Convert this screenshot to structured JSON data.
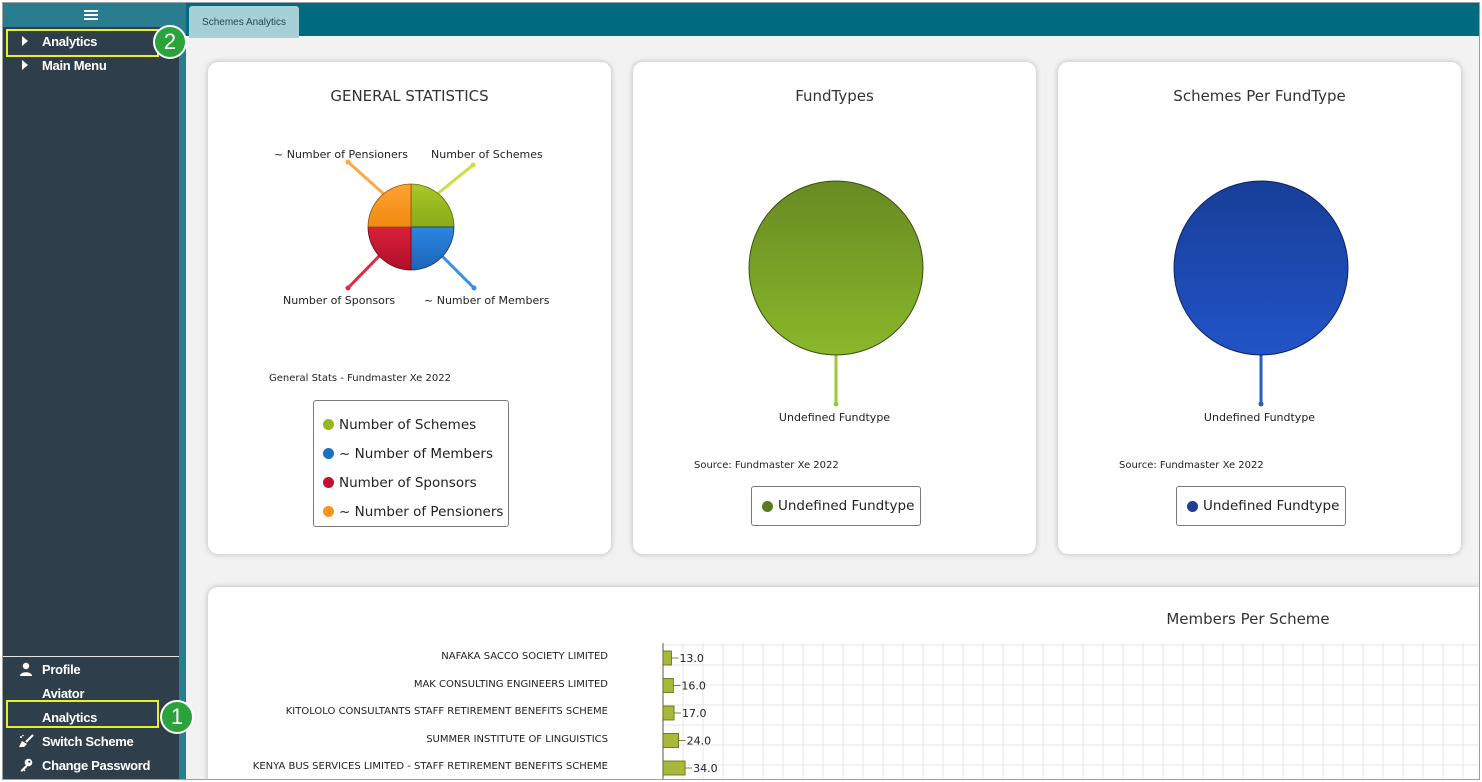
{
  "sidebar": {
    "menu_icon": "hamburger-icon",
    "top_items": [
      {
        "label": "Analytics",
        "icon": "caret-right-icon"
      },
      {
        "label": "Main Menu",
        "icon": "caret-right-icon"
      }
    ],
    "bottom_items": [
      {
        "label": "Profile",
        "icon": "user-icon"
      },
      {
        "label": "Aviator",
        "icon": ""
      },
      {
        "label": "Analytics",
        "icon": ""
      },
      {
        "label": "Switch Scheme",
        "icon": "broom-icon"
      },
      {
        "label": "Change Password",
        "icon": "key-icon"
      }
    ],
    "callouts": [
      "1",
      "2"
    ]
  },
  "colors": {
    "sidebar_bg": "#2f3e4b",
    "topbar_bg": "#006b80",
    "tab_bg": "#a6cfd8",
    "highlight": "#e8ee2a",
    "callout": "#2aa43a"
  },
  "tabs": [
    {
      "label": "Schemes Analytics",
      "active": true
    }
  ],
  "general_stats": {
    "title": "GENERAL STATISTICS",
    "caption": "General Stats - Fundmaster Xe  2022",
    "pie_labels": {
      "schemes": "Number of Schemes",
      "members": "~ Number of Members",
      "sponsors": "Number of Sponsors",
      "pensioners": "~ Number of Pensioners"
    },
    "legend": [
      {
        "label": "Number of Schemes",
        "color": "#96b81e"
      },
      {
        "label": "~ Number of Members",
        "color": "#1f6fc0"
      },
      {
        "label": "Number of Sponsors",
        "color": "#c8102e"
      },
      {
        "label": "~ Number of Pensioners",
        "color": "#f7931e"
      }
    ]
  },
  "fund_types": {
    "title": "FundTypes",
    "slice_label": "Undefined Fundtype",
    "caption": "Source: Fundmaster Xe 2022",
    "legend": [
      {
        "label": "Undefined Fundtype",
        "color": "#5a7a1f"
      }
    ]
  },
  "schemes_per_fundtype": {
    "title": "Schemes Per FundType",
    "slice_label": "Undefined Fundtype",
    "caption": "Source: Fundmaster Xe  2022",
    "legend": [
      {
        "label": "Undefined Fundtype",
        "color": "#1d3f95"
      }
    ]
  },
  "chart_data": [
    {
      "type": "pie",
      "title": "GENERAL STATISTICS",
      "categories": [
        "Number of Schemes",
        "~ Number of Members",
        "Number of Sponsors",
        "~ Number of Pensioners"
      ],
      "values": [
        25,
        25,
        25,
        25
      ]
    },
    {
      "type": "pie",
      "title": "FundTypes",
      "categories": [
        "Undefined Fundtype"
      ],
      "values": [
        100
      ]
    },
    {
      "type": "pie",
      "title": "Schemes Per FundType",
      "categories": [
        "Undefined Fundtype"
      ],
      "values": [
        100
      ]
    },
    {
      "type": "bar",
      "orientation": "horizontal",
      "title": "Members Per Scheme",
      "categories": [
        "NAFAKA SACCO SOCIETY LIMITED",
        "MAK CONSULTING ENGINEERS LIMITED",
        "KITOLOLO CONSULTANTS STAFF RETIREMENT BENEFITS SCHEME",
        "SUMMER INSTITUTE OF LINGUISTICS",
        "KENYA BUS SERVICES LIMITED - STAFF RETIREMENT BENEFITS SCHEME"
      ],
      "values": [
        13.0,
        16.0,
        17.0,
        24.0,
        34.0
      ],
      "value_labels": [
        "13.0",
        "16.0",
        "17.0",
        "24.0",
        "34.0"
      ],
      "grid": true
    }
  ]
}
